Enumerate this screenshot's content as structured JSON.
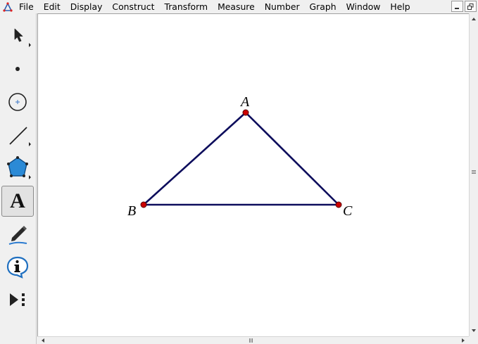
{
  "menubar": {
    "items": [
      "File",
      "Edit",
      "Display",
      "Construct",
      "Transform",
      "Measure",
      "Number",
      "Graph",
      "Window",
      "Help"
    ]
  },
  "window_controls": {
    "minimize_icon": "minimize-icon",
    "restore_icon": "restore-icon"
  },
  "toolbox": {
    "tools": [
      {
        "name": "selection-arrow-tool",
        "icon": "arrow-icon"
      },
      {
        "name": "point-tool",
        "icon": "point-icon"
      },
      {
        "name": "compass-tool",
        "icon": "circle-icon"
      },
      {
        "name": "straightedge-tool",
        "icon": "line-icon"
      },
      {
        "name": "polygon-tool",
        "icon": "pentagon-icon"
      },
      {
        "name": "text-tool",
        "icon": "text-icon",
        "label": "A",
        "active": true
      },
      {
        "name": "marker-tool",
        "icon": "pencil-icon"
      },
      {
        "name": "information-tool",
        "icon": "info-icon"
      },
      {
        "name": "custom-tools",
        "icon": "custom-tool-icon"
      }
    ]
  },
  "sketch": {
    "points": [
      {
        "label": "A"
      },
      {
        "label": "B"
      },
      {
        "label": "C"
      }
    ],
    "colors": {
      "segment": "#0d0d5c",
      "point_fill": "#cc0000",
      "point_stroke": "#5a0000",
      "canvas": "#ffffff"
    }
  }
}
